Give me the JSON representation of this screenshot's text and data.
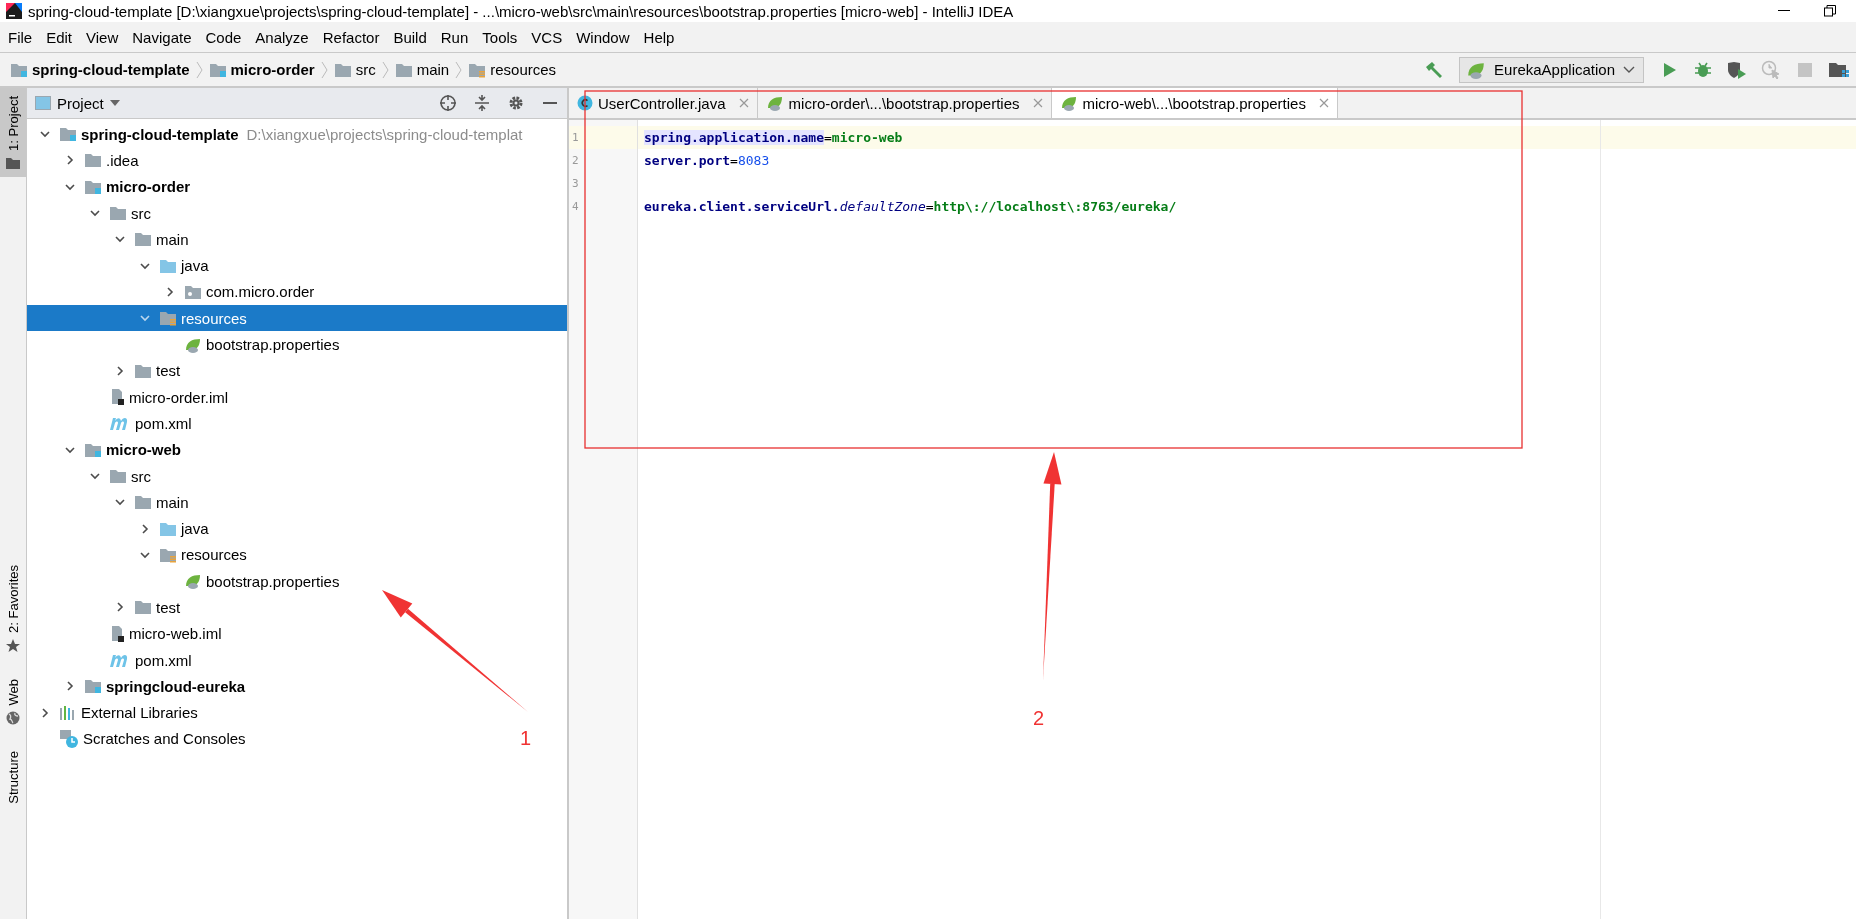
{
  "window": {
    "title": "spring-cloud-template [D:\\xiangxue\\projects\\spring-cloud-template] - ...\\micro-web\\src\\main\\resources\\bootstrap.properties [micro-web] - IntelliJ IDEA"
  },
  "menu": [
    "File",
    "Edit",
    "View",
    "Navigate",
    "Code",
    "Analyze",
    "Refactor",
    "Build",
    "Run",
    "Tools",
    "VCS",
    "Window",
    "Help"
  ],
  "breadcrumbs": [
    {
      "label": "spring-cloud-template",
      "kind": "module"
    },
    {
      "label": "micro-order",
      "kind": "module"
    },
    {
      "label": "src",
      "kind": "folder"
    },
    {
      "label": "main",
      "kind": "folder"
    },
    {
      "label": "resources",
      "kind": "resources"
    }
  ],
  "run_toolbar": {
    "configuration": "EurekaApplication"
  },
  "tool_strip": [
    {
      "label": "1: Project",
      "selected": true,
      "kind": "folder"
    },
    {
      "label": "2: Favorites",
      "selected": false,
      "kind": "star"
    },
    {
      "label": "Web",
      "selected": false,
      "kind": "globe"
    },
    {
      "label": "Structure",
      "selected": false,
      "kind": "none"
    }
  ],
  "project_panel": {
    "title": "Project",
    "tree": [
      {
        "label": "spring-cloud-template",
        "hint": "D:\\xiangxue\\projects\\spring-cloud-templat",
        "kind": "module",
        "bold": true,
        "expanded": true,
        "selected": false,
        "children": [
          {
            "label": ".idea",
            "kind": "folder",
            "bold": false,
            "expanded": false,
            "selected": false
          },
          {
            "label": "micro-order",
            "kind": "module",
            "bold": true,
            "expanded": true,
            "selected": false,
            "children": [
              {
                "label": "src",
                "kind": "folder",
                "bold": false,
                "expanded": true,
                "selected": false,
                "children": [
                  {
                    "label": "main",
                    "kind": "folder",
                    "bold": false,
                    "expanded": true,
                    "selected": false,
                    "children": [
                      {
                        "label": "java",
                        "kind": "source",
                        "bold": false,
                        "expanded": true,
                        "selected": false,
                        "children": [
                          {
                            "label": "com.micro.order",
                            "kind": "package",
                            "bold": false,
                            "expanded": false,
                            "selected": false
                          }
                        ]
                      },
                      {
                        "label": "resources",
                        "kind": "resources",
                        "bold": false,
                        "expanded": true,
                        "selected": true,
                        "children": [
                          {
                            "label": "bootstrap.properties",
                            "kind": "properties",
                            "bold": false,
                            "selected": false
                          }
                        ]
                      }
                    ]
                  },
                  {
                    "label": "test",
                    "kind": "folder",
                    "bold": false,
                    "expanded": false,
                    "selected": false
                  }
                ]
              },
              {
                "label": "micro-order.iml",
                "kind": "iml",
                "bold": false,
                "selected": false
              },
              {
                "label": "pom.xml",
                "kind": "maven",
                "bold": false,
                "selected": false
              }
            ]
          },
          {
            "label": "micro-web",
            "kind": "module",
            "bold": true,
            "expanded": true,
            "selected": false,
            "children": [
              {
                "label": "src",
                "kind": "folder",
                "bold": false,
                "expanded": true,
                "selected": false,
                "children": [
                  {
                    "label": "main",
                    "kind": "folder",
                    "bold": false,
                    "expanded": true,
                    "selected": false,
                    "children": [
                      {
                        "label": "java",
                        "kind": "source",
                        "bold": false,
                        "expanded": false,
                        "selected": false
                      },
                      {
                        "label": "resources",
                        "kind": "resources",
                        "bold": false,
                        "expanded": true,
                        "selected": false,
                        "children": [
                          {
                            "label": "bootstrap.properties",
                            "kind": "properties",
                            "bold": false,
                            "selected": false
                          }
                        ]
                      }
                    ]
                  },
                  {
                    "label": "test",
                    "kind": "folder",
                    "bold": false,
                    "expanded": false,
                    "selected": false
                  }
                ]
              },
              {
                "label": "micro-web.iml",
                "kind": "iml",
                "bold": false,
                "selected": false
              },
              {
                "label": "pom.xml",
                "kind": "maven",
                "bold": false,
                "selected": false
              }
            ]
          },
          {
            "label": "springcloud-eureka",
            "kind": "module",
            "bold": true,
            "expanded": false,
            "selected": false
          }
        ]
      },
      {
        "label": "External Libraries",
        "kind": "libraries",
        "bold": false,
        "expanded": false,
        "selected": false
      },
      {
        "label": "Scratches and Consoles",
        "kind": "scratches",
        "bold": false,
        "selected": false
      }
    ]
  },
  "editor": {
    "tabs": [
      {
        "label": "UserController.java",
        "kind": "java",
        "selected": false
      },
      {
        "label": "micro-order\\...\\bootstrap.properties",
        "kind": "properties",
        "selected": false
      },
      {
        "label": "micro-web\\...\\bootstrap.properties",
        "kind": "properties",
        "selected": true
      }
    ],
    "lines": [
      {
        "number": "1",
        "current": true,
        "tokens": [
          {
            "text": "spring.application.name",
            "kind": "key",
            "highlighted": true
          },
          {
            "text": "=",
            "kind": "sep",
            "highlighted": false
          },
          {
            "text": "micro-web",
            "kind": "value",
            "highlighted": false
          }
        ]
      },
      {
        "number": "2",
        "current": false,
        "tokens": [
          {
            "text": "server.port",
            "kind": "key",
            "highlighted": false
          },
          {
            "text": "=",
            "kind": "sep",
            "highlighted": false
          },
          {
            "text": "8083",
            "kind": "number",
            "highlighted": false
          }
        ]
      },
      {
        "number": "3",
        "current": false
      },
      {
        "number": "4",
        "current": false,
        "tokens": [
          {
            "text": "eureka.client.serviceUrl.",
            "kind": "key",
            "highlighted": false
          },
          {
            "text": "defaultZone",
            "kind": "italic",
            "highlighted": false
          },
          {
            "text": "=",
            "kind": "sep",
            "highlighted": false
          },
          {
            "text": "http\\://localhost\\:8763/eureka/",
            "kind": "value",
            "highlighted": false
          }
        ]
      }
    ]
  },
  "annotations": [
    {
      "label": "1"
    },
    {
      "label": "2"
    }
  ]
}
